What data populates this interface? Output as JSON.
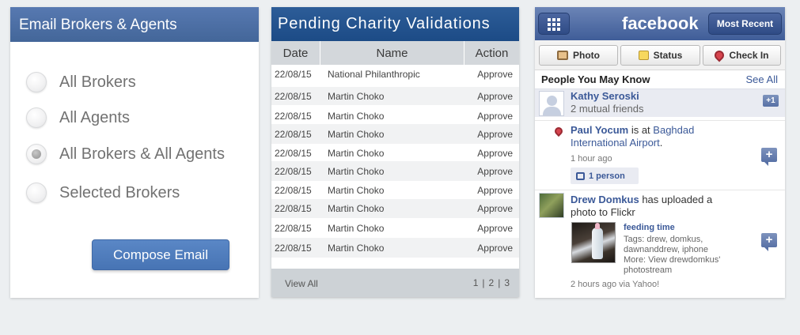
{
  "email_panel": {
    "title": "Email Brokers & Agents",
    "options": [
      {
        "label": "All Brokers",
        "selected": false
      },
      {
        "label": "All Agents",
        "selected": false
      },
      {
        "label": "All Brokers & All Agents",
        "selected": true
      },
      {
        "label": "Selected Brokers",
        "selected": false
      }
    ],
    "compose_label": "Compose Email"
  },
  "charity_panel": {
    "title": "Pending Charity Validations",
    "columns": [
      "Date",
      "Name",
      "Action"
    ],
    "rows": [
      {
        "date": "22/08/15",
        "name": "National Philanthropic",
        "action": "Approve"
      },
      {
        "date": "22/08/15",
        "name": "Martin Choko",
        "action": "Approve"
      },
      {
        "date": "22/08/15",
        "name": "Martin Choko",
        "action": "Approve"
      },
      {
        "date": "22/08/15",
        "name": "Martin Choko",
        "action": "Approve"
      },
      {
        "date": "22/08/15",
        "name": "Martin Choko",
        "action": "Approve"
      },
      {
        "date": "22/08/15",
        "name": "Martin Choko",
        "action": "Approve"
      },
      {
        "date": "22/08/15",
        "name": "Martin Choko",
        "action": "Approve"
      },
      {
        "date": "22/08/15",
        "name": "Martin Choko",
        "action": "Approve"
      },
      {
        "date": "22/08/15",
        "name": "Martin Choko",
        "action": "Approve"
      },
      {
        "date": "22/08/15",
        "name": "Martin Choko",
        "action": "Approve"
      }
    ],
    "view_all": "View All",
    "pages": [
      "1",
      "|",
      "2",
      "|",
      "3"
    ]
  },
  "facebook_panel": {
    "logo": "facebook",
    "most_recent": "Most Recent",
    "actions": {
      "photo": "Photo",
      "status": "Status",
      "check_in": "Check In"
    },
    "pymk_title": "People You May Know",
    "see_all": "See All",
    "suggestion": {
      "name": "Kathy Seroski",
      "mutual": "2 mutual friends",
      "add_label": "+1"
    },
    "story1": {
      "name": "Paul Yocum",
      "verb": " is at ",
      "place": "Baghdad International Airport",
      "end": ".",
      "time": "1 hour ago",
      "likes": "1 person"
    },
    "story2": {
      "name": "Drew Domkus",
      "text": " has uploaded a photo to Flickr",
      "attachment_title": "feeding time",
      "attachment_tags": "Tags: drew, domkus, dawnanddrew, iphone",
      "attachment_more": "More: View drewdomkus' photostream",
      "time": "2 hours ago via Yahoo!"
    },
    "colors": {
      "brand": "#3b5998"
    }
  },
  "colors": {
    "email_header": "#4a6da4",
    "charity_header": "#245590",
    "compose_button": "#4f7dbf",
    "page_background": "#eceff1"
  }
}
